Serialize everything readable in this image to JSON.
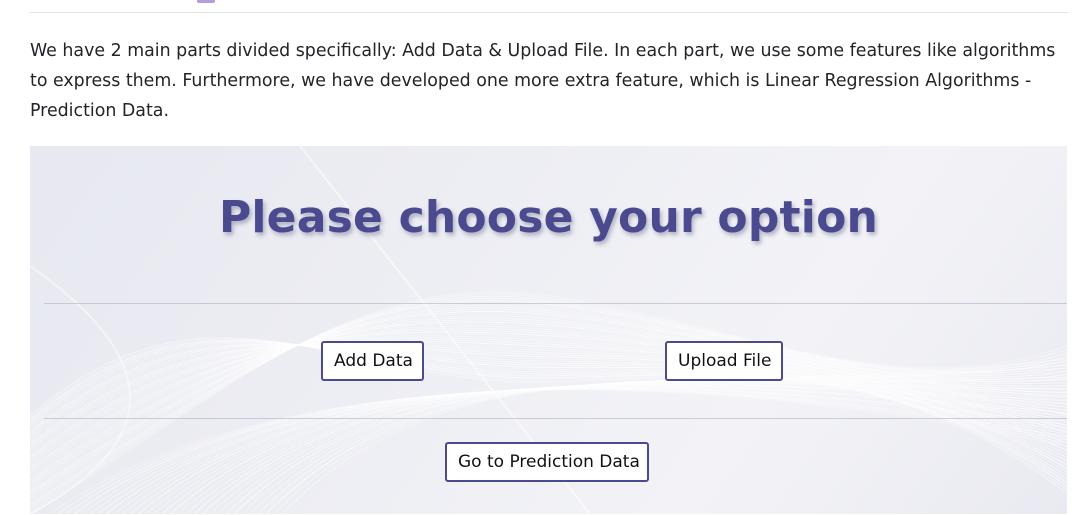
{
  "intro_text": "We have 2 main parts divided specifically: Add Data & Upload File. In each part, we use some features like algorithms to express them. Furthermore, we have developed one more extra feature, which is Linear Regression Algorithms - Prediction Data.",
  "panel": {
    "title": "Please choose your option",
    "buttons": {
      "add_data": "Add Data",
      "upload_file": "Upload File",
      "prediction": "Go to Prediction Data"
    }
  },
  "colors": {
    "accent": "#4b4a8e",
    "panel_background": "#eceef3"
  }
}
